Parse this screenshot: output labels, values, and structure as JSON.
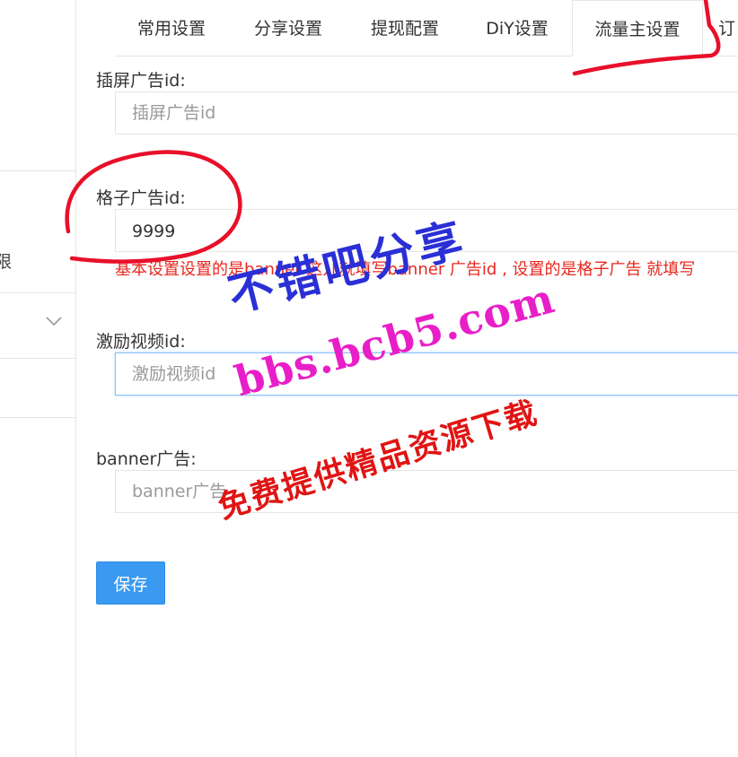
{
  "sidebar": {
    "item_fragment": "限"
  },
  "tabs": [
    {
      "label": "常用设置",
      "active": false
    },
    {
      "label": "分享设置",
      "active": false
    },
    {
      "label": "提现配置",
      "active": false
    },
    {
      "label": "DiY设置",
      "active": false
    },
    {
      "label": "流量主设置",
      "active": true
    },
    {
      "label": "订",
      "active": false
    }
  ],
  "form": {
    "interstitial": {
      "label": "插屏广告id:",
      "value": "",
      "placeholder": "插屏广告id"
    },
    "grid": {
      "label": "格子广告id:",
      "value": "9999",
      "hint": "基本设置设置的是banner 这儿就填写banner 广告id , 设置的是格子广告 就填写"
    },
    "reward_video": {
      "label": "激励视频id:",
      "value": "",
      "placeholder": "激励视频id"
    },
    "banner": {
      "label": "banner广告:",
      "value": "",
      "placeholder": "banner广告"
    },
    "save_label": "保存"
  },
  "watermark": {
    "line1": "不错吧分享",
    "line2": "bbs.bcb5.com",
    "line3": "免费提供精品资源下载"
  },
  "colors": {
    "primary_button": "#3a9af2",
    "hint_text": "#e8271f",
    "annotation_red": "#e8102a",
    "watermark_blue": "#2a2fd6",
    "watermark_magenta": "#e81fc8",
    "watermark_red": "#e01414"
  }
}
